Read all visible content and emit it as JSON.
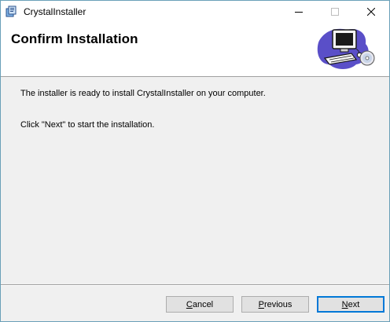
{
  "window": {
    "title": "CrystalInstaller",
    "controls": [
      "minimize-icon",
      "maximize-icon",
      "close-icon"
    ]
  },
  "banner": {
    "title": "Confirm Installation",
    "icon": "computer-setup-icon"
  },
  "content": {
    "line1": "The installer is ready to install CrystalInstaller on your computer.",
    "line2": "Click \"Next\" to start the installation."
  },
  "buttons": {
    "cancel": {
      "mnemonic": "C",
      "rest": "ancel"
    },
    "previous": {
      "mnemonic": "P",
      "rest": "revious"
    },
    "next": {
      "mnemonic": "N",
      "rest": "ext"
    }
  },
  "colors": {
    "accent": "#0078d7",
    "window_border": "#6aa0b8",
    "dialog_bg": "#f0f0f0"
  }
}
